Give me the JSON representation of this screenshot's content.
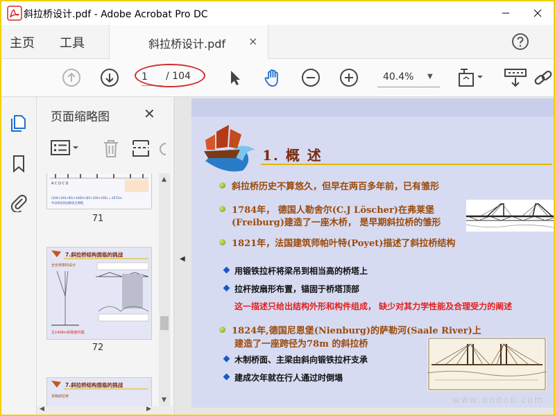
{
  "window": {
    "title": "斜拉桥设计.pdf - Adobe Acrobat Pro DC"
  },
  "menu": {
    "home": "主页",
    "tools": "工具"
  },
  "tab": {
    "label": "斜拉桥设计.pdf",
    "close": "×"
  },
  "toolbar": {
    "page_current": "1",
    "page_total": "/ 104",
    "zoom": "40.4%"
  },
  "thumbnails": {
    "title": "页面缩略图",
    "close": "✕",
    "pages": [
      {
        "label": "71",
        "heading": "",
        "line1": "(106+100+85)+1400+(85+100+106) = 2672m",
        "line2": "中点附近的边跨及主跨距"
      },
      {
        "label": "72",
        "heading": "7.斜拉桥结构面临的挑战",
        "line1": "全长桥梁的设计",
        "line2": "主1408m的跨度问题"
      },
      {
        "label": "",
        "heading": "7.斜拉桥结构面临的挑战",
        "line1": "多跨斜拉桥",
        "line2": ""
      }
    ]
  },
  "slide": {
    "title": "1. 概  述",
    "bullets": [
      {
        "kind": "green",
        "text": "斜拉桥历史不算悠久，但早在两百多年前，已有雏形"
      },
      {
        "kind": "green",
        "text": "1784年， 德国人勒舍尔(C.J  Löscher)在弗莱堡"
      },
      {
        "kind": "cont",
        "text": "(Freiburg)建造了一座木桥， 是早期斜拉桥的雏形"
      },
      {
        "kind": "green",
        "text": "1821年，法国建筑师帕叶特(Poyet)描述了斜拉桥结构"
      },
      {
        "kind": "blue",
        "text": "用锻铁拉杆将梁吊到相当高的桥塔上"
      },
      {
        "kind": "blue",
        "text": "拉杆按扇形布置，锚固于桥塔顶部"
      },
      {
        "kind": "red",
        "text": "这一描述只给出结构外形和构件组成， 缺少对其力学性能及合理受力的阐述"
      },
      {
        "kind": "green",
        "text": "1824年,德国尼恩堡(Nienburg)的萨勒河(Saale  River)上"
      },
      {
        "kind": "cont",
        "text": "建造了一座跨径为78m 的斜拉桥"
      },
      {
        "kind": "blue",
        "text": "木制桥面、主梁由斜向锻铁拉杆支承"
      },
      {
        "kind": "blue",
        "text": "建成次年就在行人通过时倒塌"
      }
    ],
    "watermark": "www.ondoo.com"
  },
  "colors": {
    "frame": "#f0d000",
    "slide_bg": "#d7dbf2",
    "heading": "#9b4a0a",
    "alert": "#e2211c",
    "bullet_blue": "#1b58c8",
    "acrobat_red": "#d42a2a"
  },
  "icons": [
    "acrobat-logo-icon",
    "minimize-icon",
    "maximize-icon",
    "close-icon",
    "help-icon",
    "page-up-icon",
    "page-down-icon",
    "select-arrow-icon",
    "hand-icon",
    "zoom-out-icon",
    "zoom-in-icon",
    "fit-page-icon",
    "scroll-mode-icon",
    "link-icon",
    "thumbnails-icon",
    "bookmark-icon",
    "attachment-icon",
    "options-icon",
    "delete-icon",
    "extract-icon"
  ]
}
